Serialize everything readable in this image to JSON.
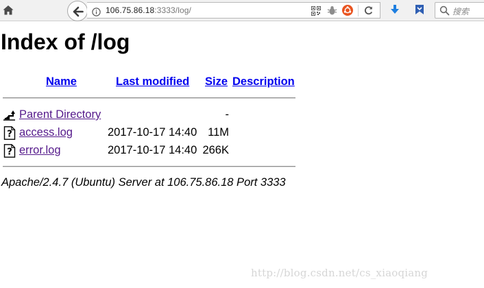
{
  "browser": {
    "url_host": "106.75.86.18",
    "url_rest": ":3333/log/",
    "search_placeholder": "搜索",
    "icons": {
      "home": "home-icon",
      "back": "back-arrow-icon",
      "site_info": "info-icon",
      "qr": "qr-code-icon",
      "extension": "bug-extension-icon",
      "ubuntu": "ubuntu-icon",
      "reload": "reload-icon",
      "downloads": "download-arrow-icon",
      "pocket": "bookmark-icon",
      "search": "search-icon"
    }
  },
  "page": {
    "title": "Index of /log",
    "columns": {
      "name": "Name",
      "last_modified": "Last modified",
      "size": "Size",
      "description": "Description"
    },
    "rows": [
      {
        "name": "Parent Directory",
        "date": "",
        "size": "-",
        "icon": "back-folder-icon"
      },
      {
        "name": "access.log",
        "date": "2017-10-17 14:40",
        "size": "11M",
        "icon": "unknown-file-icon"
      },
      {
        "name": "error.log",
        "date": "2017-10-17 14:40",
        "size": "266K",
        "icon": "unknown-file-icon"
      }
    ],
    "address": "Apache/2.4.7 (Ubuntu) Server at 106.75.86.18 Port 3333"
  },
  "watermark": "http://blog.csdn.net/cs_xiaoqiang",
  "colors": {
    "link": "#0000ee",
    "visited_link": "#551a8b",
    "toolbar_bg": "#f1f1f1",
    "download_blue": "#1e7fe0",
    "ubuntu_orange": "#e95420"
  }
}
